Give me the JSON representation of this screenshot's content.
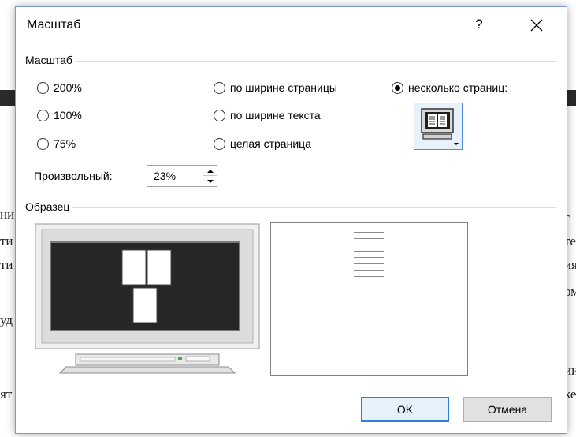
{
  "dialog": {
    "title": "Масштаб",
    "help_glyph": "?"
  },
  "zoom_group": {
    "label": "Масштаб",
    "options": [
      {
        "label": "200%",
        "checked": false
      },
      {
        "label": "100%",
        "checked": false
      },
      {
        "label": "75%",
        "checked": false
      },
      {
        "label": "по ширине страницы",
        "checked": false
      },
      {
        "label": "по ширине текста",
        "checked": false
      },
      {
        "label": "целая страница",
        "checked": false
      },
      {
        "label": "несколько страниц:",
        "checked": true
      }
    ],
    "custom_label": "Произвольный:",
    "custom_value": "23%"
  },
  "preview_group": {
    "label": "Образец"
  },
  "buttons": {
    "ok": "OK",
    "cancel": "Отмена"
  },
  "colors": {
    "accent_border": "#2f7fd8",
    "monitor_screen": "#262626"
  },
  "background_doc": {
    "left_fragments": [
      "ни",
      "ти",
      "ти",
      "",
      "уд",
      "",
      "ят"
    ],
    "right_fragments": [
      "г",
      "те",
      "ия",
      "ом",
      "",
      "ии",
      "ке"
    ]
  }
}
